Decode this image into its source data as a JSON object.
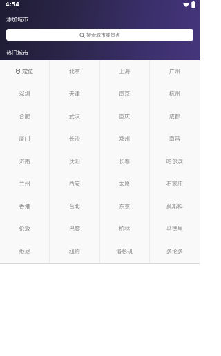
{
  "status_bar": {
    "time": "4:54"
  },
  "page_title": "添加城市",
  "search": {
    "placeholder": "搜索城市或景点"
  },
  "section_title": "热门城市",
  "locate_label": "定位",
  "cities": [
    "北京",
    "上海",
    "广州",
    "深圳",
    "天津",
    "南京",
    "杭州",
    "合肥",
    "武汉",
    "重庆",
    "成都",
    "厦门",
    "长沙",
    "郑州",
    "南昌",
    "济南",
    "沈阳",
    "长春",
    "哈尔滨",
    "兰州",
    "西安",
    "太原",
    "石家庄",
    "香港",
    "台北",
    "东京",
    "莫斯科",
    "伦敦",
    "巴黎",
    "柏林",
    "马德里",
    "悉尼",
    "纽约",
    "洛杉矶",
    "多伦多"
  ],
  "colors": {
    "header_start": "#1e1c34",
    "header_end": "#45357c"
  }
}
